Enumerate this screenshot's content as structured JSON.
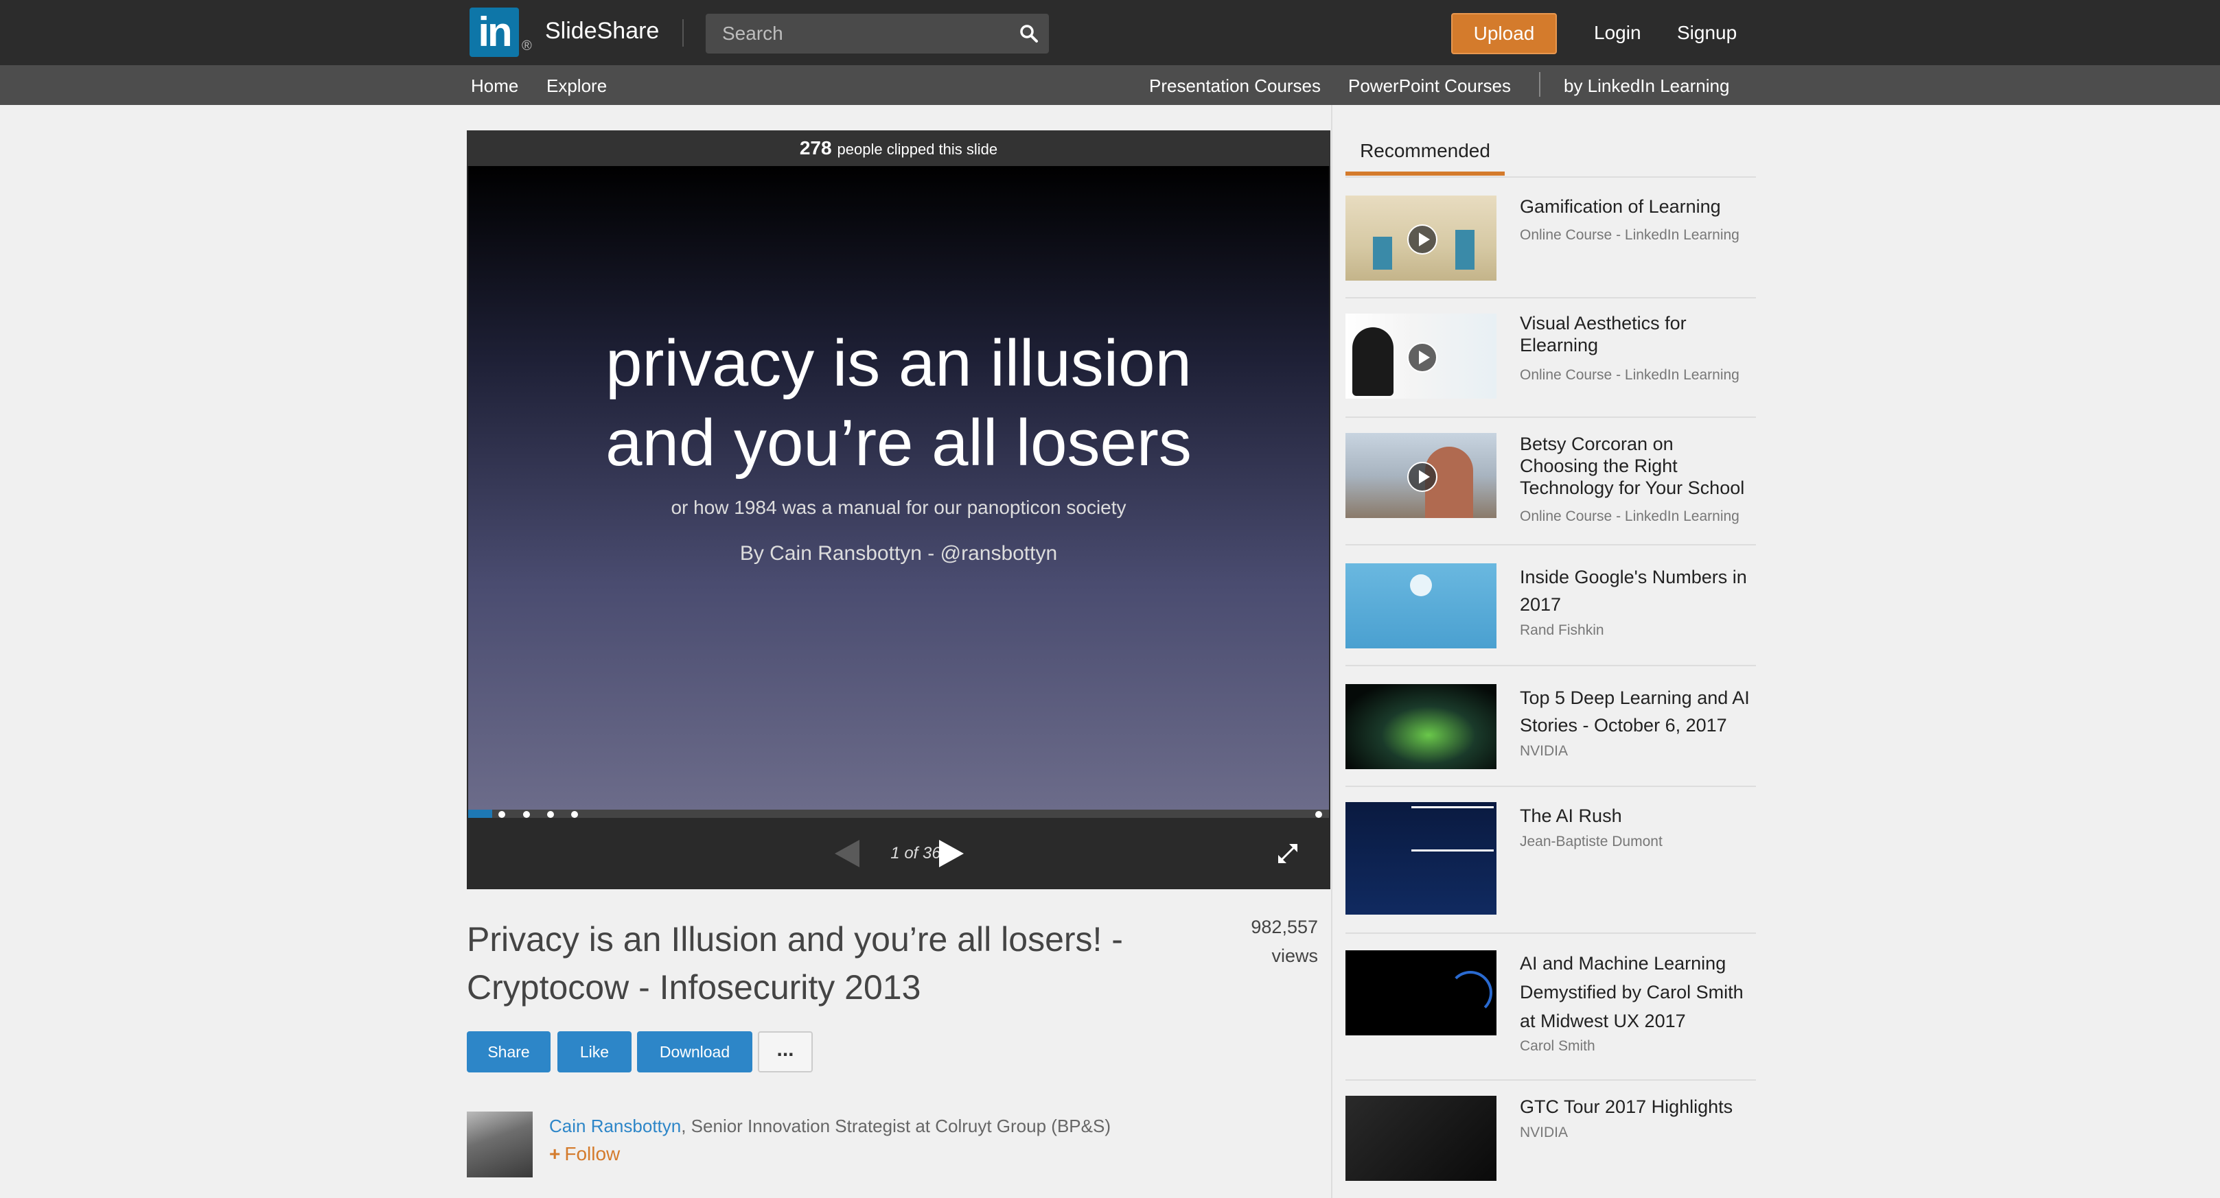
{
  "header": {
    "brand": "SlideShare",
    "search_placeholder": "Search",
    "upload_label": "Upload",
    "login_label": "Login",
    "signup_label": "Signup"
  },
  "subnav": {
    "home": "Home",
    "explore": "Explore",
    "presentation_courses": "Presentation Courses",
    "powerpoint_courses": "PowerPoint Courses",
    "by_linkedin": "by LinkedIn Learning"
  },
  "player": {
    "clip_count": "278",
    "clip_text": "people clipped this slide",
    "slide_title_line1": "privacy is an illusion",
    "slide_title_line2": "and you’re all losers",
    "slide_subtitle": "or how 1984 was a manual for our panopticon society",
    "slide_byline": "By Cain Ransbottyn - @ransbottyn",
    "page_indicator": "1 of 36",
    "current_page": 1,
    "total_pages": 36
  },
  "presentation": {
    "title": "Privacy is an Illusion and you’re all losers! - Cryptocow - Infosecurity 2013",
    "views_count": "982,557",
    "views_label": "views",
    "share_label": "Share",
    "like_label": "Like",
    "download_label": "Download",
    "more_label": "...",
    "author_name": "Cain Ransbottyn",
    "author_title": ", Senior Innovation Strategist at Colruyt Group (BP&S)",
    "follow_label": "Follow"
  },
  "recommended": {
    "tab_label": "Recommended",
    "items": [
      {
        "title": "Gamification of Learning",
        "subtitle": "Online Course - LinkedIn Learning"
      },
      {
        "title": "Visual Aesthetics for Elearning",
        "subtitle": "Online Course - LinkedIn Learning"
      },
      {
        "title": "Betsy Corcoran on Choosing the Right Technology for Your School",
        "subtitle": "Online Course - LinkedIn Learning"
      },
      {
        "title": "Inside Google's Numbers in 2017",
        "subtitle": "Rand Fishkin"
      },
      {
        "title": "Top 5 Deep Learning and AI Stories - October 6, 2017",
        "subtitle": "NVIDIA"
      },
      {
        "title": "The AI Rush",
        "subtitle": "Jean-Baptiste Dumont"
      },
      {
        "title": "AI and Machine Learning Demystified by Carol Smith at Midwest UX 2017",
        "subtitle": "Carol Smith"
      },
      {
        "title": "GTC Tour 2017 Highlights",
        "subtitle": "NVIDIA"
      }
    ]
  },
  "colors": {
    "accent_orange": "#d47b2c",
    "button_blue": "#2d86c8",
    "linkedin_blue": "#0e76a8",
    "header_bg": "#2c2c2c"
  }
}
